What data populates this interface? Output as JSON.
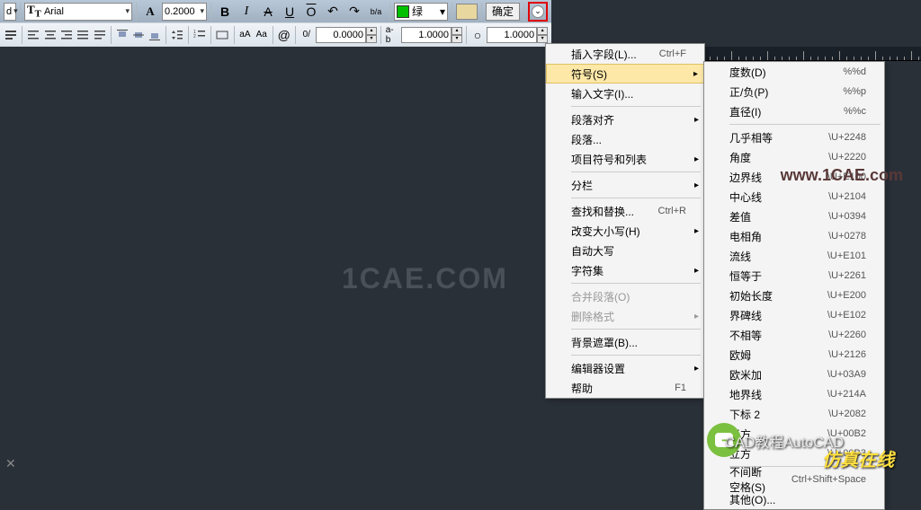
{
  "toolbar": {
    "style_dd": "d",
    "font_name": "Arial",
    "font_prefix": "A",
    "size": "0.2000",
    "bold": "B",
    "italic": "I",
    "strike": "A",
    "underline": "U",
    "overline": "O",
    "undo": "↶",
    "redo": "↷",
    "stack": "b/a",
    "color_label": "绿",
    "ok": "确定",
    "circle": "⌄",
    "tracking1": "0.0000",
    "tracking2": "1.0000",
    "tracking3": "1.0000",
    "at": "@",
    "oblique": "0/",
    "abc": "a-b",
    "eye": "○"
  },
  "menu1": [
    {
      "label": "插入字段(L)...",
      "shortcut": "Ctrl+F"
    },
    {
      "label": "符号(S)",
      "sub": true,
      "hover": true
    },
    {
      "label": "输入文字(I)..."
    },
    {
      "sep": true
    },
    {
      "label": "段落对齐",
      "sub": true
    },
    {
      "label": "段落..."
    },
    {
      "label": "项目符号和列表",
      "sub": true
    },
    {
      "sep": true
    },
    {
      "label": "分栏",
      "sub": true
    },
    {
      "sep": true
    },
    {
      "label": "查找和替换...",
      "shortcut": "Ctrl+R"
    },
    {
      "label": "改变大小写(H)",
      "sub": true
    },
    {
      "label": "自动大写"
    },
    {
      "label": "字符集",
      "sub": true
    },
    {
      "sep": true
    },
    {
      "label": "合并段落(O)",
      "disabled": true
    },
    {
      "label": "删除格式",
      "sub": true,
      "disabled": true
    },
    {
      "sep": true
    },
    {
      "label": "背景遮罩(B)..."
    },
    {
      "sep": true
    },
    {
      "label": "编辑器设置",
      "sub": true
    },
    {
      "label": "帮助",
      "shortcut": "F1"
    }
  ],
  "menu2": [
    {
      "label": "度数(D)",
      "shortcut": "%%d"
    },
    {
      "label": "正/负(P)",
      "shortcut": "%%p"
    },
    {
      "label": "直径(I)",
      "shortcut": "%%c"
    },
    {
      "sep": true
    },
    {
      "label": "几乎相等",
      "shortcut": "\\U+2248"
    },
    {
      "label": "角度",
      "shortcut": "\\U+2220"
    },
    {
      "label": "边界线",
      "shortcut": "\\U+E100"
    },
    {
      "label": "中心线",
      "shortcut": "\\U+2104"
    },
    {
      "label": "差值",
      "shortcut": "\\U+0394"
    },
    {
      "label": "电相角",
      "shortcut": "\\U+0278"
    },
    {
      "label": "流线",
      "shortcut": "\\U+E101"
    },
    {
      "label": "恒等于",
      "shortcut": "\\U+2261"
    },
    {
      "label": "初始长度",
      "shortcut": "\\U+E200"
    },
    {
      "label": "界碑线",
      "shortcut": "\\U+E102"
    },
    {
      "label": "不相等",
      "shortcut": "\\U+2260"
    },
    {
      "label": "欧姆",
      "shortcut": "\\U+2126"
    },
    {
      "label": "欧米加",
      "shortcut": "\\U+03A9"
    },
    {
      "label": "地界线",
      "shortcut": "\\U+214A"
    },
    {
      "label": "下标 2",
      "shortcut": "\\U+2082"
    },
    {
      "label": "平方",
      "shortcut": "\\U+00B2"
    },
    {
      "label": "立方",
      "shortcut": "\\U+00B3"
    },
    {
      "sep": true
    },
    {
      "label": "不间断空格(S)",
      "shortcut": "Ctrl+Shift+Space"
    },
    {
      "label": "其他(O)..."
    }
  ],
  "watermarks": {
    "main": "1CAE.COM",
    "url": "www.1CAE.com"
  },
  "captions": {
    "line1": "CAD教程AutoCAD",
    "line2": "仿真在线"
  }
}
